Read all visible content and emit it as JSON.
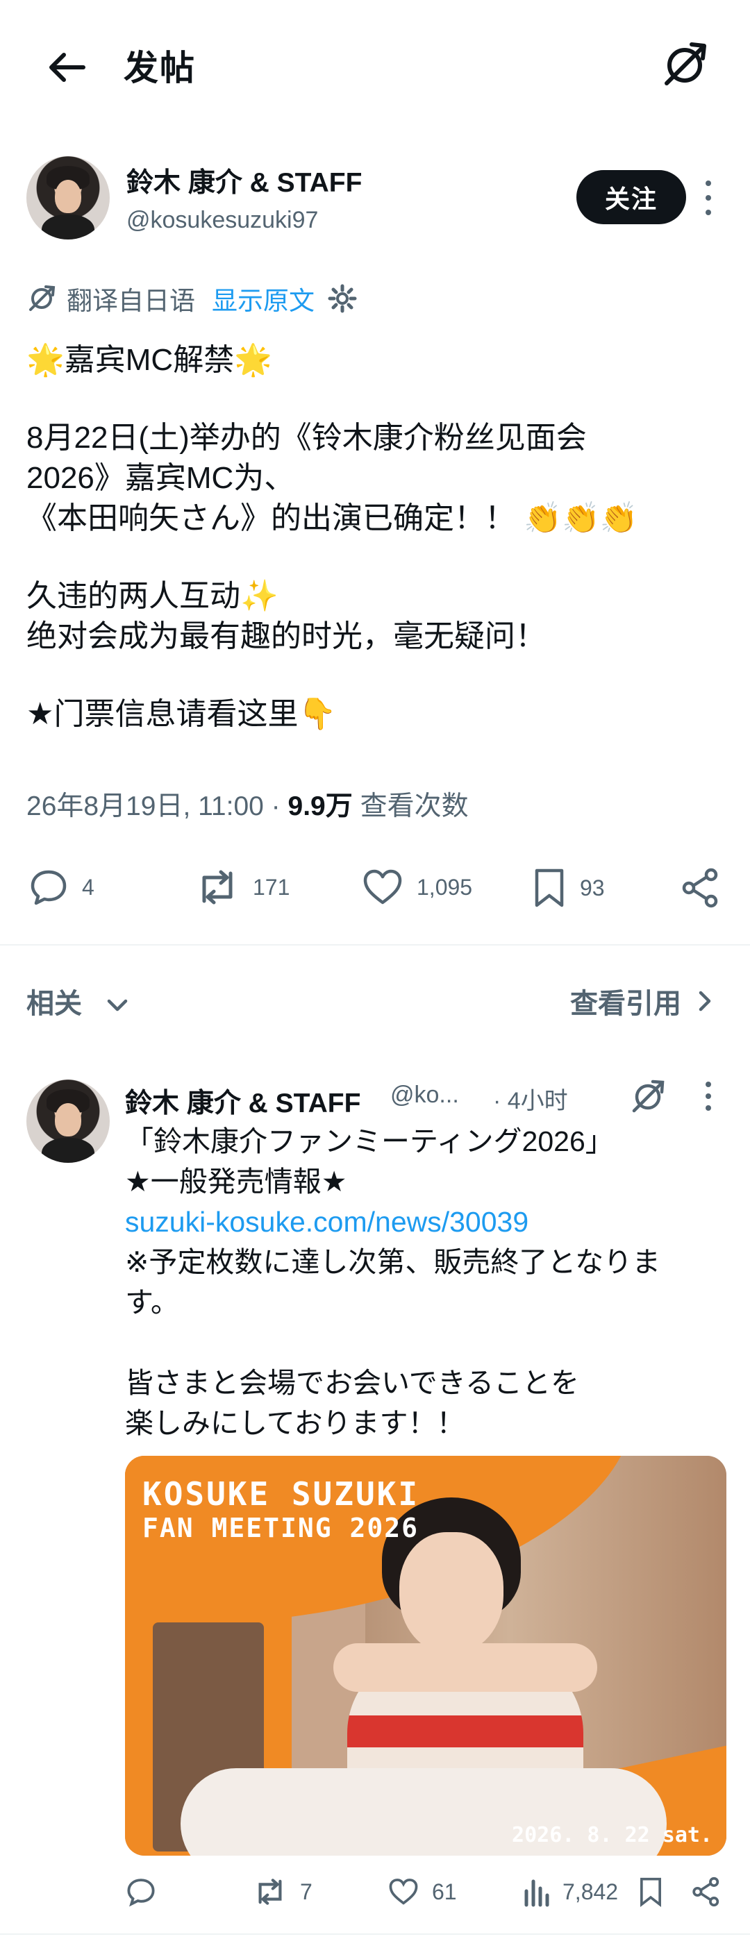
{
  "header": {
    "title": "发帖"
  },
  "post": {
    "author_name": "鈴木 康介 & STAFF",
    "author_handle": "@kosukesuzuki97",
    "follow_label": "关注",
    "translated_from": "翻译自日语",
    "show_original": "显示原文",
    "body_lines": [
      "🌟嘉宾MC解禁🌟",
      "",
      "8月22日(土)举办的《铃木康介粉丝见面会",
      "2026》嘉宾MC为、",
      "《本田响矢さん》的出演已确定！！ 👏👏👏",
      "",
      "久违的两人互动✨",
      "绝对会成为最有趣的时光，毫无疑问！",
      "",
      "★门票信息请看这里👇"
    ],
    "timestamp": "26年8月19日, 11:00",
    "separator": " · ",
    "views": "9.9万",
    "views_label": "查看次数",
    "stats": {
      "replies": "4",
      "reposts": "171",
      "likes": "1,095",
      "bookmarks": "93"
    }
  },
  "related": {
    "label": "相关",
    "quotes_label": "查看引用"
  },
  "reply": {
    "author_name": "鈴木 康介 & STAFF",
    "author_handle": "@ko...",
    "time": "· 4小时",
    "lines": [
      {
        "text": "「鈴木康介ファンミーティング2026」",
        "type": "text"
      },
      {
        "text": "★一般発売情報★",
        "type": "text"
      },
      {
        "text": "suzuki-kosuke.com/news/30039",
        "type": "url"
      },
      {
        "text": "※予定枚数に達し次第、販売終了となりま",
        "type": "text"
      },
      {
        "text": "す。",
        "type": "text"
      },
      {
        "text": "",
        "type": "gap"
      },
      {
        "text": "皆さまと会場でお会いできることを",
        "type": "text"
      },
      {
        "text": "楽しみにしております！！",
        "type": "text"
      }
    ],
    "banner": {
      "title_line1": "KOSUKE SUZUKI",
      "title_line2": "FAN MEETING 2026",
      "date": "2026. 8. 22 sat."
    },
    "stats": {
      "reposts": "7",
      "likes": "61",
      "views": "7,842"
    }
  },
  "colors": {
    "accent": "#1d9bf0",
    "text": "#0f1419",
    "muted": "#536471",
    "banner_orange": "#f08a24"
  }
}
